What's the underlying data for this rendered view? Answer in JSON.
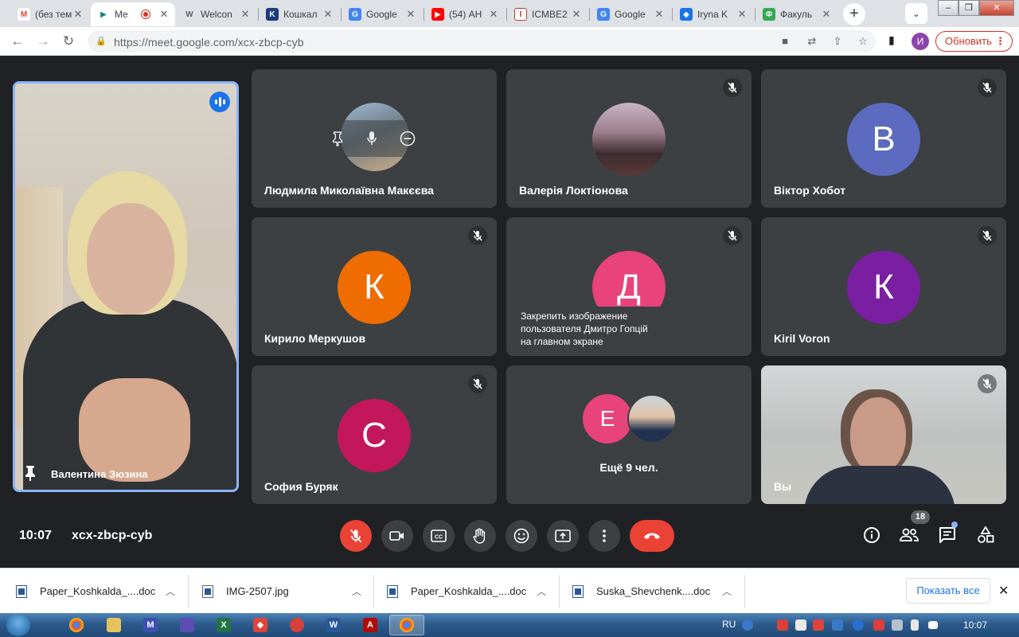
{
  "browser": {
    "tabs": [
      {
        "title": "(без тем",
        "color": "#ea4335",
        "glyph": "M"
      },
      {
        "title": "Me",
        "color": "#00897b",
        "glyph": "M"
      },
      {
        "title": "Welcon",
        "color": "#5f6368",
        "glyph": "W"
      },
      {
        "title": "Кошкал",
        "color": "#1a3d7c",
        "glyph": "K"
      },
      {
        "title": "Google",
        "color": "#4285f4",
        "glyph": "G"
      },
      {
        "title": "(54) АН",
        "color": "#ff0000",
        "glyph": "▶"
      },
      {
        "title": "ICMBE2",
        "color": "#c0392b",
        "glyph": "I"
      },
      {
        "title": "Google",
        "color": "#4285f4",
        "glyph": "G"
      },
      {
        "title": "Iryna K",
        "color": "#1a73e8",
        "glyph": "I"
      },
      {
        "title": "Факуль",
        "color": "#34a853",
        "glyph": "Ф"
      }
    ],
    "url": "https://meet.google.com/xcx-zbcp-cyb",
    "profile_initial": "И",
    "update_label": "Обновить"
  },
  "meet": {
    "speaker": {
      "name": "Валентина Зюзина"
    },
    "tiles": [
      {
        "name": "Людмила Миколаївна Макєєва"
      },
      {
        "name": "Валерія Локтіонова"
      },
      {
        "name": "Віктор Хобот",
        "initial": "В",
        "color": "#5c6bc0"
      },
      {
        "name": "Кирило Меркушов",
        "initial": "К",
        "color": "#ef6c00"
      },
      {
        "initial": "Д",
        "color": "#e8437a",
        "hint": [
          "Закрепить изображение",
          "пользователя Дмитро Гопцій",
          "на главном экране"
        ]
      },
      {
        "name": "Kiril Voron",
        "initial": "К",
        "color": "#7b1fa2"
      },
      {
        "name": "София Буряк",
        "initial": "С",
        "color": "#c2185b"
      },
      {
        "more_initial": "Е",
        "more_color": "#e8437a",
        "more_text": "Ещё 9 чел."
      },
      {
        "name": "Вы"
      }
    ],
    "time": "10:07",
    "code": "xcx-zbcp-cyb",
    "participant_count": "18"
  },
  "downloads": {
    "items": [
      "Paper_Koshkalda_....doc",
      "IMG-2507.jpg",
      "Paper_Koshkalda_....doc",
      "Suska_Shevchenk....doc"
    ],
    "show_all": "Показать все"
  },
  "taskbar": {
    "lang": "RU",
    "time": "10:07"
  }
}
